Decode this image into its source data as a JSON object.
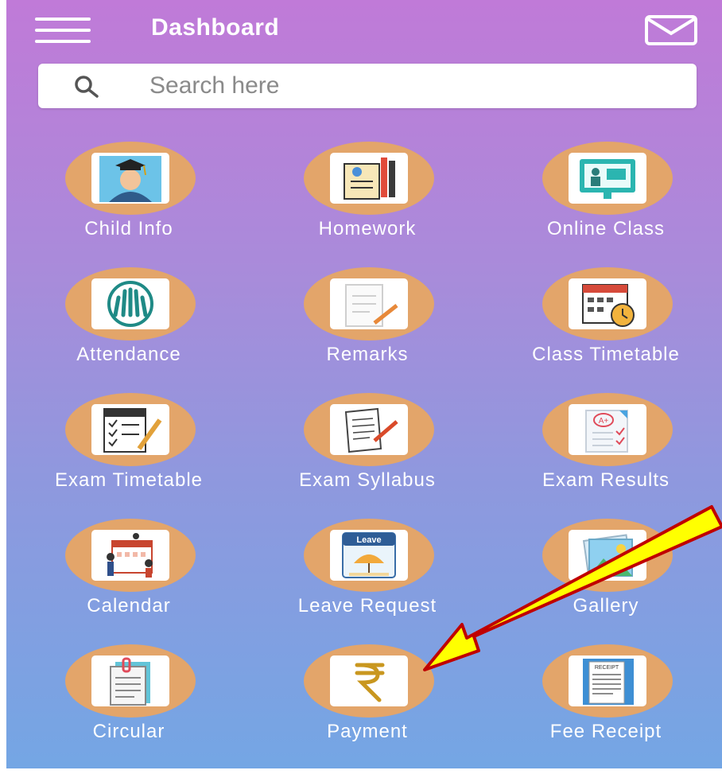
{
  "header": {
    "title": "Dashboard"
  },
  "search": {
    "placeholder": "Search here"
  },
  "tiles": [
    {
      "label": "Child Info"
    },
    {
      "label": "Homework"
    },
    {
      "label": "Online Class"
    },
    {
      "label": "Attendance"
    },
    {
      "label": "Remarks"
    },
    {
      "label": "Class Timetable"
    },
    {
      "label": "Exam Timetable"
    },
    {
      "label": "Exam Syllabus"
    },
    {
      "label": "Exam Results"
    },
    {
      "label": "Calendar"
    },
    {
      "label": "Leave Request"
    },
    {
      "label": "Gallery"
    },
    {
      "label": "Circular"
    },
    {
      "label": "Payment"
    },
    {
      "label": "Fee Receipt"
    }
  ],
  "icon_text": {
    "leave": "Leave",
    "receipt": "RECEIPT",
    "grade": "A+"
  },
  "colors": {
    "tile_circle": "#e3a56a",
    "arrow_fill": "#ffff00",
    "arrow_outline": "#c00000"
  }
}
